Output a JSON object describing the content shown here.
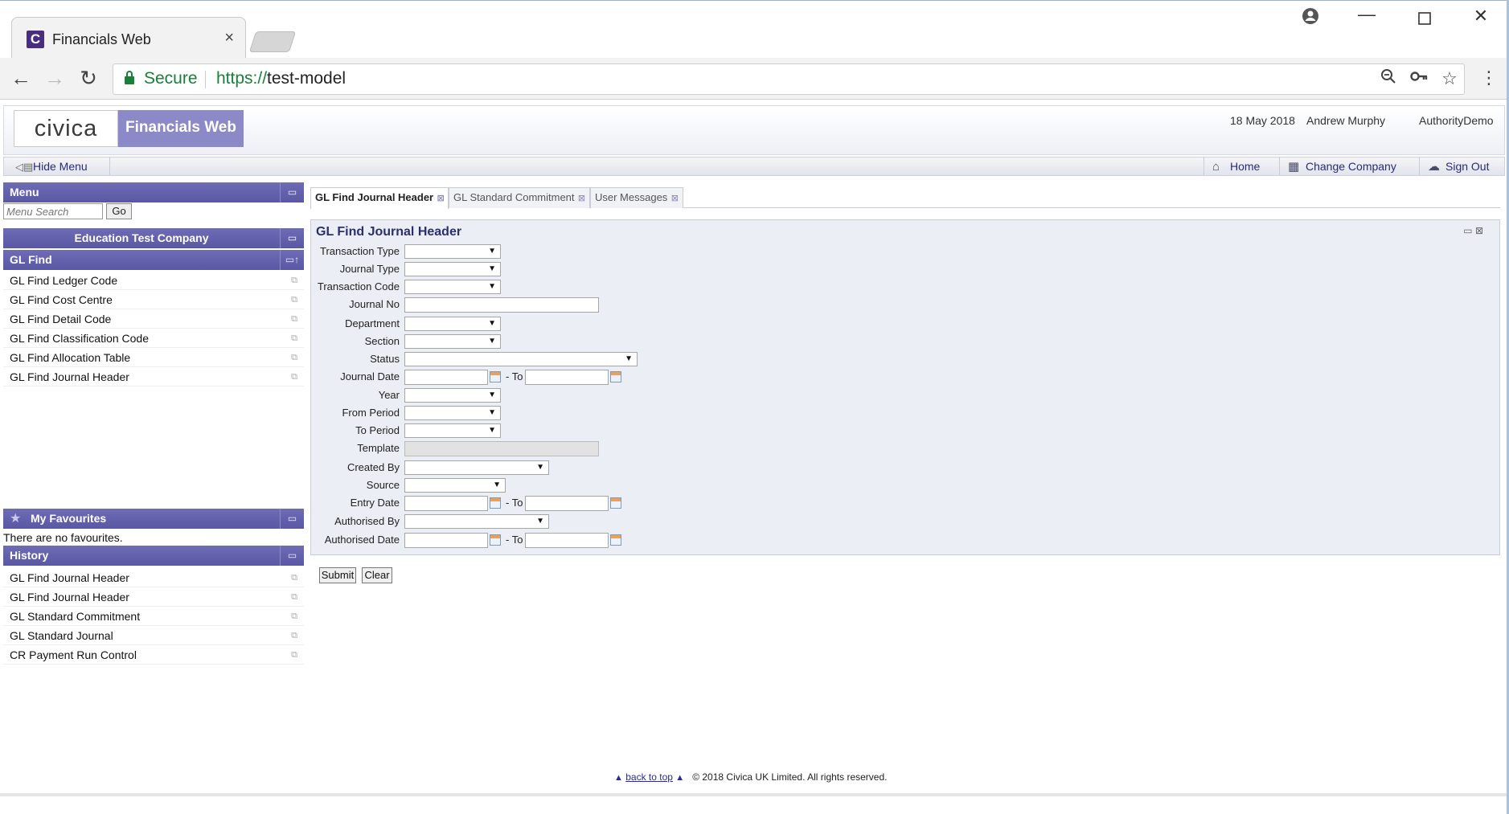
{
  "browser": {
    "tab_title": "Financials Web",
    "favicon_letter": "C",
    "secure_label": "Secure",
    "url_scheme": "https://",
    "url_host": "test-model"
  },
  "header": {
    "logo_text": "civica",
    "product_name": "Financials Web",
    "date": "18 May 2018",
    "user": "Andrew Murphy",
    "company_code": "AuthorityDemo"
  },
  "menubar": {
    "hide_menu": "Hide Menu",
    "home": "Home",
    "change_company": "Change Company",
    "sign_out": "Sign Out"
  },
  "sidebar": {
    "menu_title": "Menu",
    "search_placeholder": "Menu Search",
    "go_label": "Go",
    "company": "Education Test Company",
    "section_title": "GL Find",
    "items": [
      "GL Find Ledger Code",
      "GL Find Cost Centre",
      "GL Find Detail Code",
      "GL Find Classification Code",
      "GL Find Allocation Table",
      "GL Find Journal Header"
    ],
    "favourites_title": "My Favourites",
    "favourites_empty": "There are no favourites.",
    "history_title": "History",
    "history": [
      "GL Find Journal Header",
      "GL Find Journal Header",
      "GL Standard Commitment",
      "GL Standard Journal",
      "CR Payment Run Control"
    ]
  },
  "content_tabs": [
    {
      "label": "GL Find Journal Header",
      "active": true
    },
    {
      "label": "GL Standard Commitment",
      "active": false
    },
    {
      "label": "User Messages",
      "active": false
    }
  ],
  "form": {
    "title": "GL Find Journal Header",
    "labels": {
      "transaction_type": "Transaction Type",
      "journal_type": "Journal Type",
      "transaction_code": "Transaction Code",
      "journal_no": "Journal No",
      "department": "Department",
      "section": "Section",
      "status": "Status",
      "journal_date": "Journal Date",
      "year": "Year",
      "from_period": "From Period",
      "to_period": "To Period",
      "template": "Template",
      "created_by": "Created By",
      "source": "Source",
      "entry_date": "Entry Date",
      "authorised_by": "Authorised By",
      "authorised_date": "Authorised Date"
    },
    "to_label": "- To",
    "submit": "Submit",
    "clear": "Clear"
  },
  "footer": {
    "back_to_top": "back to top",
    "copyright": "© 2018 Civica UK Limited. All rights reserved."
  }
}
